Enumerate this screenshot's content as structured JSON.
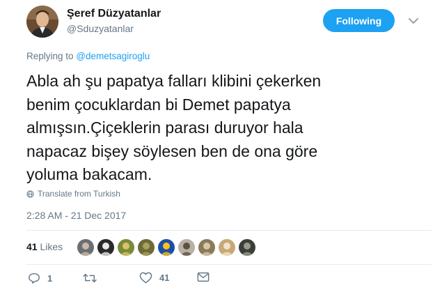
{
  "author": {
    "display_name": "Şeref Düzyatanlar",
    "handle": "@Sduzyatanlar",
    "avatar_icon": "user-avatar"
  },
  "follow_button": {
    "label": "Following",
    "color": "#1da1f2"
  },
  "reply_context": {
    "prefix": "Replying to ",
    "mention": "@demetsagiroglu"
  },
  "tweet": {
    "lines": [
      "Abla ah şu papatya falları klibini çekerken",
      "benim çocuklardan bi Demet papatya",
      "almışsın.Çiçeklerin parası duruyor hala",
      "napacaz bişey söylesen ben de ona göre",
      "yoluma bakacam."
    ]
  },
  "translate": {
    "label": "Translate from Turkish",
    "icon": "globe-icon"
  },
  "timestamp": "2:28 AM - 21 Dec 2017",
  "likes": {
    "count": "41",
    "label": " Likes"
  },
  "likers": [
    {
      "color": "#6b6f75",
      "accent": "#c9b9a8"
    },
    {
      "color": "#2a2a2a",
      "accent": "#e8e8e8"
    },
    {
      "color": "#7a8a3c",
      "accent": "#d8c26a"
    },
    {
      "color": "#6d6a3a",
      "accent": "#a7a15a"
    },
    {
      "color": "#1e4fa8",
      "accent": "#f5c518"
    },
    {
      "color": "#b9b1a3",
      "accent": "#5a5247"
    },
    {
      "color": "#8a7a5a",
      "accent": "#d6c7a6"
    },
    {
      "color": "#c8a878",
      "accent": "#f1e3c8"
    },
    {
      "color": "#3b3f3a",
      "accent": "#9a9a8a"
    }
  ],
  "actions": {
    "reply_count": "1",
    "retweet_count": "",
    "like_count": "41"
  },
  "colors": {
    "text_primary": "#14171a",
    "text_secondary": "#657786",
    "link": "#1da1f2",
    "divider": "#e6ecf0"
  }
}
